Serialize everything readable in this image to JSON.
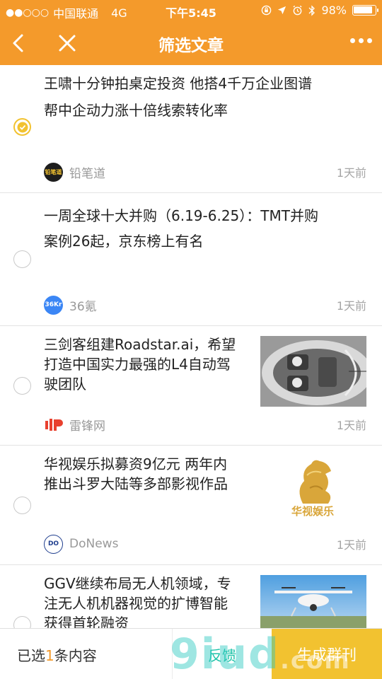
{
  "status_bar": {
    "signal": "●●○○○",
    "carrier": "中国联通",
    "network": "4G",
    "time": "下午5:45",
    "battery": "98%"
  },
  "nav": {
    "title": "筛选文章"
  },
  "articles": [
    {
      "title_line1": "王啸十分钟拍桌定投资 他搭4千万企业图谱",
      "title_line2": "帮中企动力涨十倍线索转化率",
      "source": "铅笔道",
      "source_icon_text": "铅笔道",
      "time": "1天前",
      "checked": true
    },
    {
      "title_line1": "一周全球十大并购（6.19-6.25）：TMT并购",
      "title_line2": "案例26起，京东榜上有名",
      "source": "36氪",
      "source_icon_text": "36Kr",
      "time": "1天前",
      "checked": false
    },
    {
      "title_line1": "三剑客组建Roadstar.ai，希望",
      "title_line2": "打造中国实力最强的L4自动驾",
      "title_line3": "驶团队",
      "source": "雷锋网",
      "time": "1天前",
      "checked": false
    },
    {
      "title_line1": "华视娱乐拟募资9亿元 两年内",
      "title_line2": "推出斗罗大陆等多部影视作品",
      "source": "DoNews",
      "source_icon_text": "DO",
      "time": "1天前",
      "checked": false,
      "thumb_text": "华视娱乐"
    },
    {
      "title_line1": "GGV继续布局无人机领域，专",
      "title_line2": "注无人机机器视觉的扩博智能",
      "title_line3": "获得首轮融资",
      "checked": false
    }
  ],
  "footer": {
    "selected_prefix": "已选",
    "selected_count": "1",
    "selected_suffix": "条内容",
    "feedback": "反馈",
    "generate": "生成群刊"
  },
  "watermark": {
    "text": "9iud",
    "suffix": ".com"
  },
  "colors": {
    "accent": "#f49a2b",
    "check": "#f2c230",
    "feedback": "#1ec3a8"
  }
}
